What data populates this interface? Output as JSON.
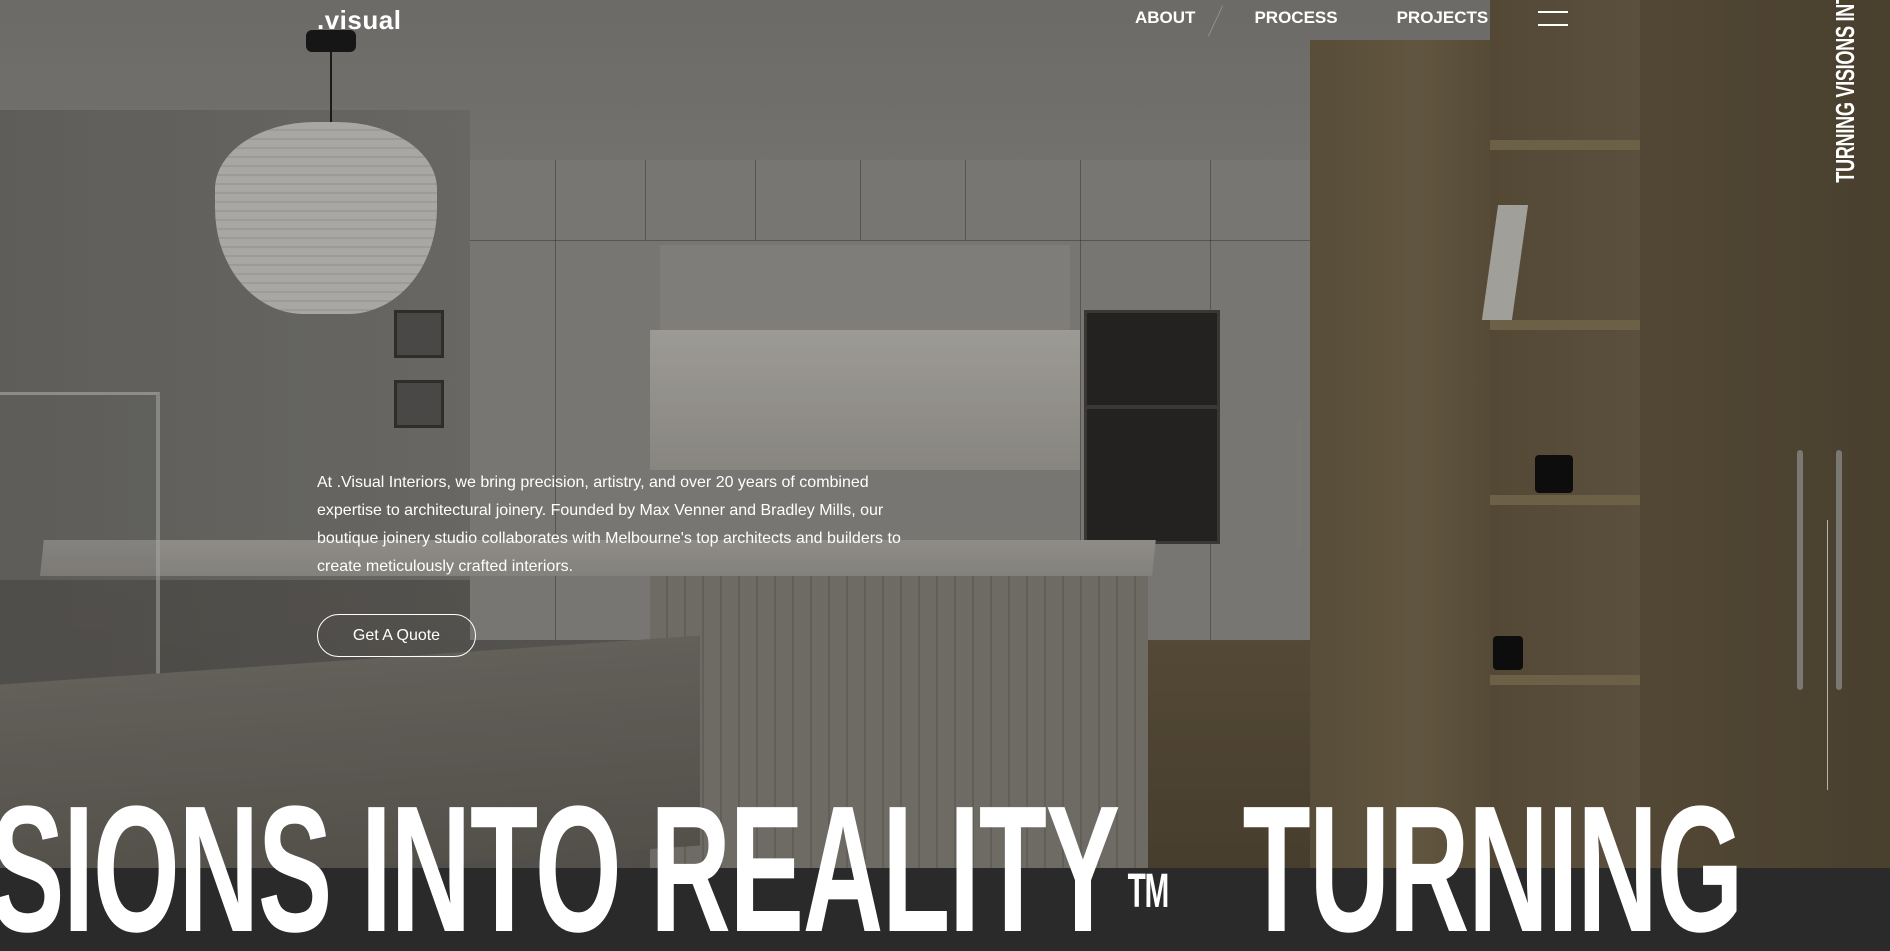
{
  "brand": {
    "logo": ".visual"
  },
  "nav": {
    "items": [
      {
        "label": "ABOUT"
      },
      {
        "label": "PROCESS"
      },
      {
        "label": "PROJECTS"
      }
    ],
    "menu_icon": "hamburger-icon"
  },
  "hero": {
    "intro": "At .Visual Interiors, we bring precision, artistry, and over 20 years of combined expertise to architectural joinery. Founded by Max Venner and Bradley Mills, our boutique joinery studio collaborates with Melbourne's top architects and builders to create meticulously crafted interiors.",
    "cta_label": "Get A Quote",
    "vertical_tagline": "TURNING VISIONS INTO REALITY",
    "marquee_segment_1": "SIONS INTO REALITY",
    "trademark": "TM",
    "marquee_segment_2": "TURNING"
  },
  "colors": {
    "text": "#ffffff",
    "band": "#2a2a2a"
  }
}
